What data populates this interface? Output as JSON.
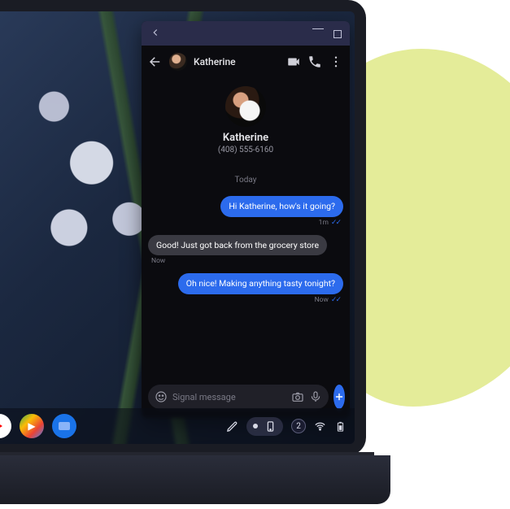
{
  "app": {
    "titlebar": {},
    "header": {
      "contact_name": "Katherine"
    },
    "profile": {
      "name": "Katherine",
      "phone": "(408) 555-6160"
    },
    "date_separator": "Today",
    "messages": [
      {
        "dir": "out",
        "text": "Hi Katherine, how's it going?",
        "time": "1m",
        "read": true
      },
      {
        "dir": "in",
        "text": "Good! Just got back from the grocery store",
        "time": "Now",
        "read": false
      },
      {
        "dir": "out",
        "text": "Oh nice! Making anything tasty tonight?",
        "time": "Now",
        "read": true
      }
    ],
    "composer": {
      "placeholder": "Signal message"
    }
  },
  "taskbar": {
    "badge": "2"
  }
}
